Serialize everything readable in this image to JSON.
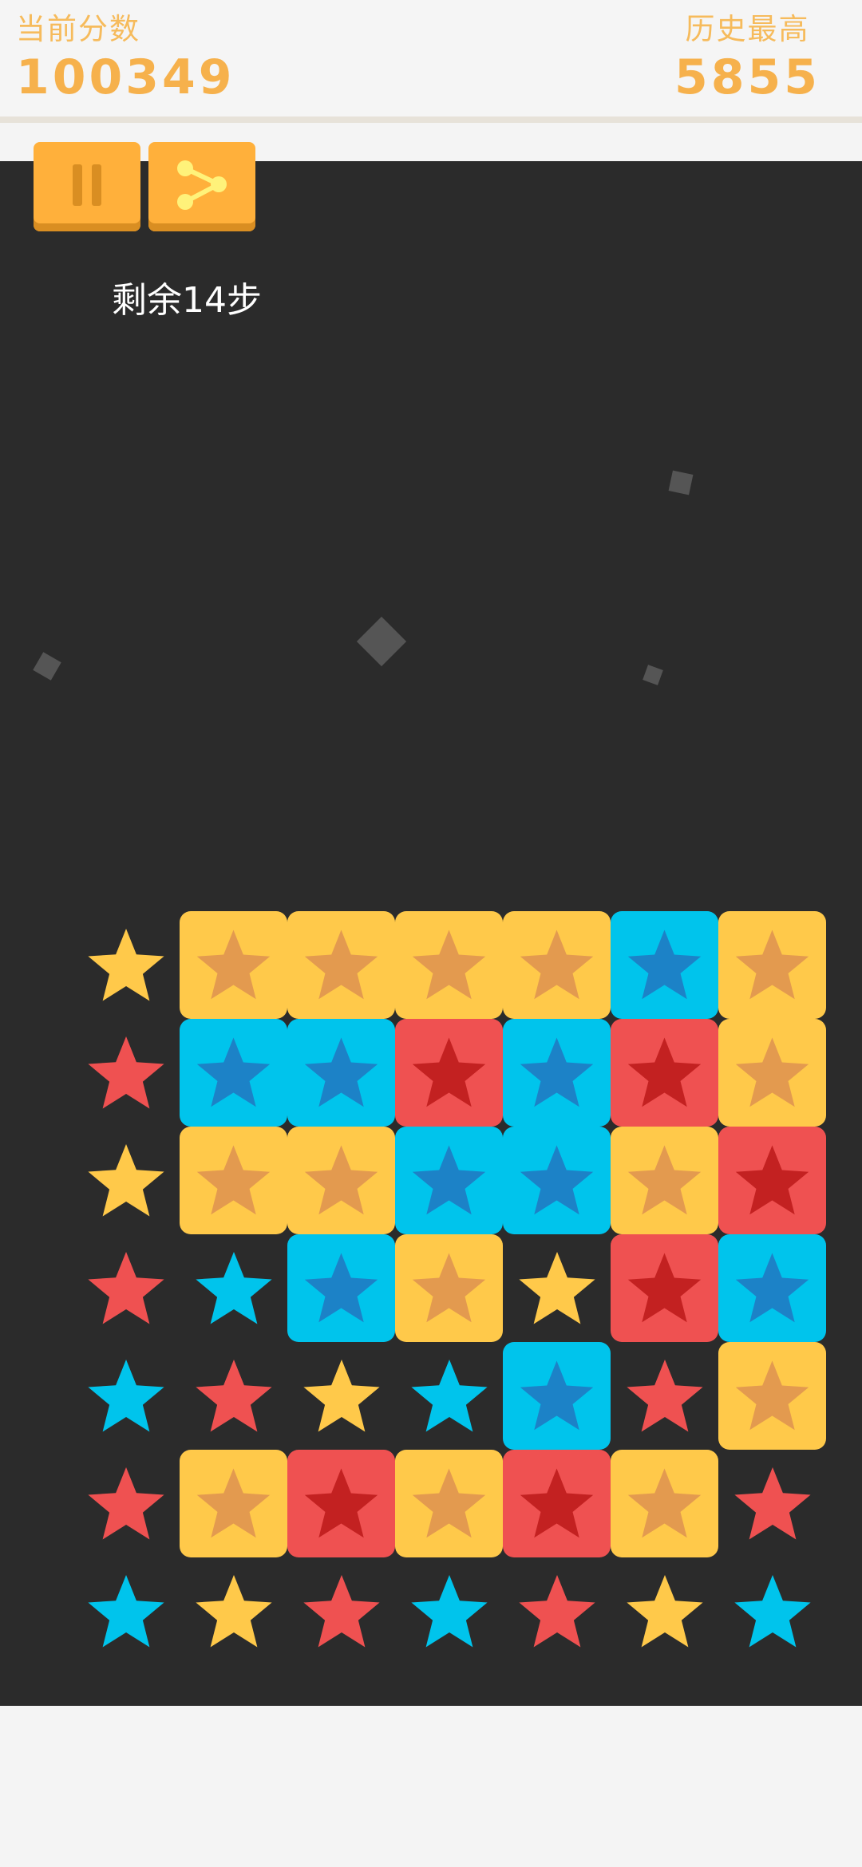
{
  "header": {
    "current_label": "当前分数",
    "current_score": "100349",
    "best_label": "历史最高",
    "best_score": "5855"
  },
  "controls": {
    "pause_icon": "pause-icon",
    "share_icon": "share-icon"
  },
  "steps_text": "剩余14步",
  "colors": {
    "yellow": "#ffc94a",
    "yellow_star": "#e39a4f",
    "yellow_dark": "#e39a4f",
    "cyan": "#00c4ec",
    "cyan_star": "#1c82c7",
    "cyan_dark": "#1c82c7",
    "red": "#ef5151",
    "red_star": "#c32121",
    "red_dark": "#c32121",
    "board": "#2b2b2b"
  },
  "grid": {
    "columns": 7,
    "rows": 7,
    "cells": [
      [
        "y",
        "Y",
        "Y",
        "Y",
        "Y",
        "C",
        "Y"
      ],
      [
        "r",
        "C",
        "C",
        "R",
        "C",
        "R",
        "Y"
      ],
      [
        "y",
        "Y",
        "Y",
        "C",
        "C",
        "Y",
        "R"
      ],
      [
        "r",
        "c",
        "C",
        "Y",
        "y",
        "R",
        "C"
      ],
      [
        "c",
        "r",
        "y",
        "c",
        "C",
        "r",
        "Y"
      ],
      [
        "r",
        "Y",
        "R",
        "Y",
        "R",
        "Y",
        "r"
      ],
      [
        "c",
        "y",
        "r",
        "c",
        "r",
        "y",
        "c"
      ]
    ]
  }
}
